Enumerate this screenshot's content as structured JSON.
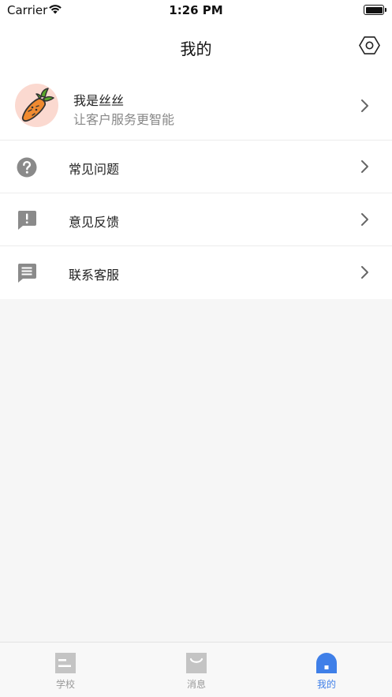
{
  "status_bar": {
    "carrier": "Carrier",
    "time": "1:26 PM"
  },
  "nav": {
    "title": "我的",
    "settings_icon": "settings-hexagon-icon"
  },
  "profile": {
    "name": "我是丝丝",
    "tagline": "让客户服务更智能",
    "avatar_icon": "carrot-icon"
  },
  "menu": [
    {
      "label": "常见问题",
      "icon": "help-circle-icon"
    },
    {
      "label": "意见反馈",
      "icon": "feedback-bubble-icon"
    },
    {
      "label": "联系客服",
      "icon": "message-bubble-icon"
    }
  ],
  "tabs": [
    {
      "label": "学校",
      "icon": "school-icon",
      "active": false
    },
    {
      "label": "消息",
      "icon": "message-icon",
      "active": false
    },
    {
      "label": "我的",
      "icon": "profile-icon",
      "active": true
    }
  ],
  "colors": {
    "accent": "#3f7fe8",
    "icon_gray": "#8a8a8a",
    "tab_inactive": "#c4c4c4",
    "avatar_bg": "#fbd9d0"
  }
}
